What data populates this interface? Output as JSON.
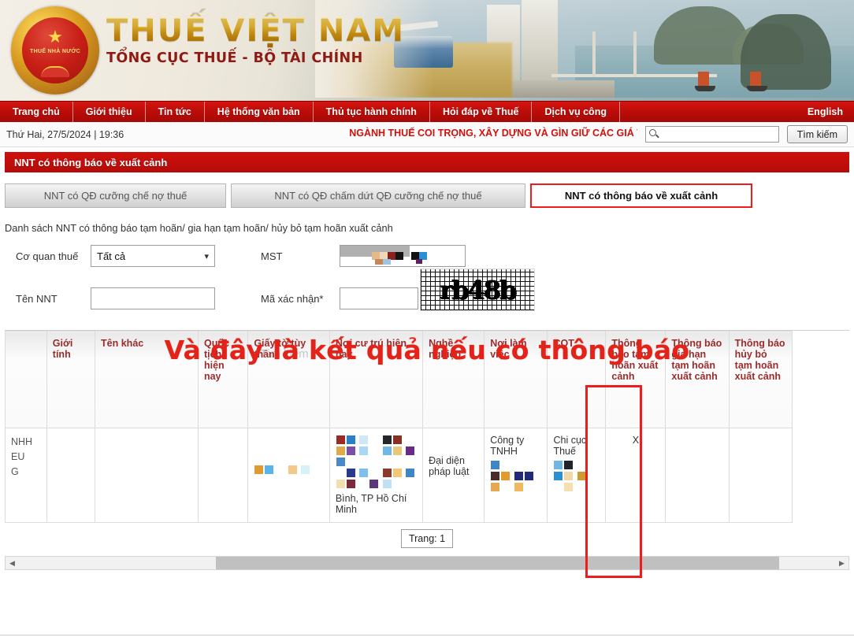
{
  "header": {
    "brand_main": "THUẾ VIỆT NAM",
    "brand_sub": "TỔNG CỤC THUẾ - BỘ TÀI CHÍNH",
    "emblem_text": "THUẾ NHÀ NƯỚC"
  },
  "nav": {
    "items": [
      "Trang chủ",
      "Giới thiệu",
      "Tin tức",
      "Hệ thống văn bản",
      "Thủ tục hành chính",
      "Hỏi đáp về Thuế",
      "Dịch vụ công"
    ],
    "english": "English"
  },
  "utility": {
    "datetime": "Thứ Hai, 27/5/2024 | 19:36",
    "ticker": "NGÀNH THUẾ COI TRỌNG, XÂY DỰNG VÀ GÌN GIỮ CÁC GIÁ TRỊ “MINH BẠCH – (",
    "search_placeholder": "",
    "search_value": "",
    "search_button": "Tìm kiếm",
    "search_icon": "search-icon"
  },
  "page": {
    "title": "NNT có thông báo về xuất cảnh"
  },
  "tabs": [
    {
      "label": "NNT có QĐ cưỡng chế nợ thuế",
      "active": false
    },
    {
      "label": "NNT có QĐ chấm dứt QĐ cưỡng chế nợ thuế",
      "active": false
    },
    {
      "label": "NNT có thông báo về xuất cảnh",
      "active": true
    }
  ],
  "list_caption": "Danh sách NNT có thông báo tạm hoãn/ gia hạn tạm hoãn/ hủy bỏ tạm hoãn xuất cảnh",
  "form": {
    "co_quan_thue_label": "Cơ quan thuế",
    "co_quan_thue_value": "Tất cả",
    "co_quan_thue_options": [
      "Tất cả"
    ],
    "ten_nnt_label": "Tên NNT",
    "ten_nnt_value": "",
    "mst_label": "MST",
    "mst_value": "",
    "ma_xac_nhan_label": "Mã xác nhận*",
    "ma_xac_nhan_value": "",
    "captcha_text": "rb48b",
    "chevron_icon": "chevron-down-icon"
  },
  "annotation": {
    "text": "Và đây là kết quả nếu có thông báo",
    "color": "#e2231a",
    "ghost_text": "Tìm kiếm"
  },
  "table": {
    "columns": [
      "",
      "Giới tính",
      "Tên khác",
      "Quốc tịch hiện nay",
      "Giấy tờ tùy thân",
      "Nơi cư trú hiện nay",
      "Nghề nghiệp",
      "Nơi làm việc",
      "CQT",
      "Thông báo tạm hoãn xuất cảnh",
      "Thông báo gia hạn tạm hoãn xuất cảnh",
      "Thông báo hủy bỏ tạm hoãn xuất cảnh"
    ],
    "highlight_column_index": 9,
    "highlight_color": "#ee1c1c",
    "rows": [
      {
        "c0": "NHH EU G",
        "c1": "",
        "c2": "",
        "c3": "",
        "c4": "",
        "c5": "Bình, TP Hồ Chí Minh",
        "c6": "Đại diện pháp luật",
        "c7": "Công ty TNHH",
        "c8": "Chi cục Thuế",
        "c9": "X",
        "c10": "",
        "c11": ""
      }
    ]
  },
  "pager": {
    "label": "Trang: 1"
  },
  "scrollbar": {
    "left_arrow": "chevron-left-icon",
    "right_arrow": "chevron-right-icon"
  }
}
